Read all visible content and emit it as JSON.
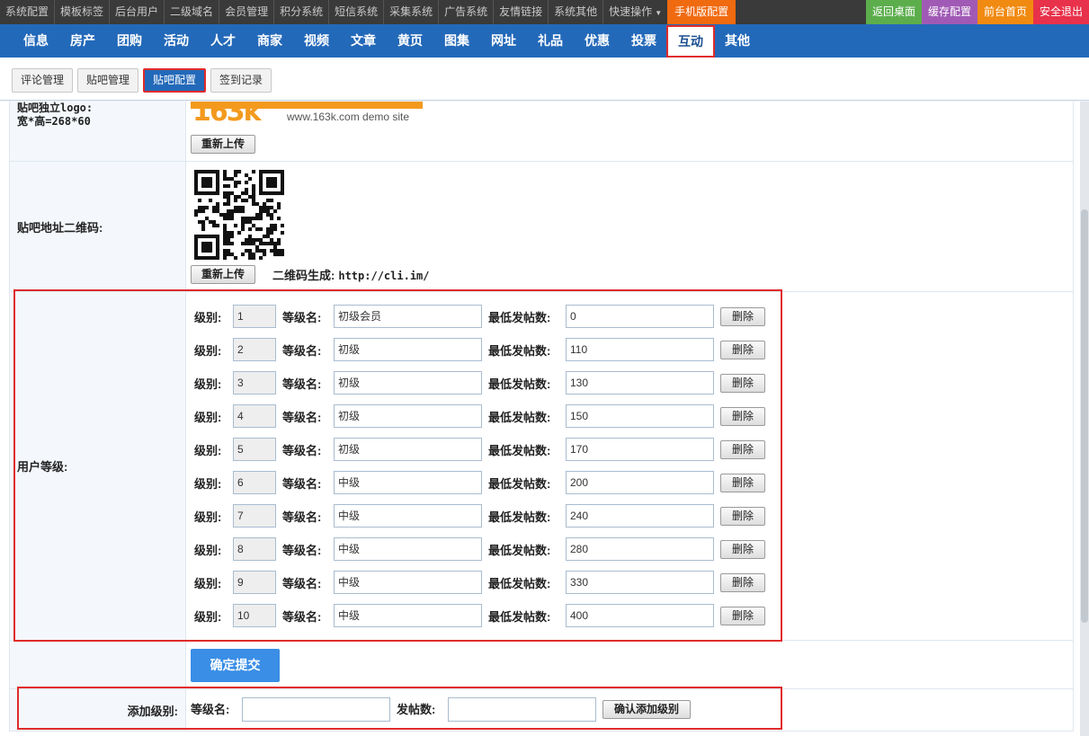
{
  "topbar": {
    "items": [
      "系统配置",
      "模板标签",
      "后台用户",
      "二级域名",
      "会员管理",
      "积分系统",
      "短信系统",
      "采集系统",
      "广告系统",
      "友情链接",
      "系统其他",
      "快速操作"
    ],
    "mobile": "手机版配置",
    "right": [
      {
        "label": "返回桌面",
        "color": "#5cae4c"
      },
      {
        "label": "缓存配置",
        "color": "#a05ab5"
      },
      {
        "label": "前台首页",
        "color": "#f08a10"
      },
      {
        "label": "安全退出",
        "color": "#e8314a"
      }
    ]
  },
  "mainnav": {
    "items": [
      "信息",
      "房产",
      "团购",
      "活动",
      "人才",
      "商家",
      "视频",
      "文章",
      "黄页",
      "图集",
      "网址",
      "礼品",
      "优惠",
      "投票",
      "互动",
      "其他"
    ],
    "active_index": 14
  },
  "subtabs": {
    "items": [
      "评论管理",
      "贴吧管理",
      "贴吧配置",
      "签到记录"
    ],
    "active_index": 2
  },
  "logo_row": {
    "label_line1": "贴吧独立logo:",
    "label_line2": "宽*高=268*60",
    "logo_text": "163k",
    "logo_site": "www.163k.com demo site",
    "upload_button": "重新上传"
  },
  "qr_row": {
    "label": "贴吧地址二维码:",
    "upload_button": "重新上传",
    "gen_label": "二维码生成:",
    "gen_url": "http://cli.im/"
  },
  "levels": {
    "label": "用户等级:",
    "level_label": "级别:",
    "name_label": "等级名:",
    "min_label": "最低发帖数:",
    "delete_label": "删除",
    "rows": [
      {
        "level": "1",
        "name": "初级会员",
        "min": "0"
      },
      {
        "level": "2",
        "name": "初级",
        "min": "110"
      },
      {
        "level": "3",
        "name": "初级",
        "min": "130"
      },
      {
        "level": "4",
        "name": "初级",
        "min": "150"
      },
      {
        "level": "5",
        "name": "初级",
        "min": "170"
      },
      {
        "level": "6",
        "name": "中级",
        "min": "200"
      },
      {
        "level": "7",
        "name": "中级",
        "min": "240"
      },
      {
        "level": "8",
        "name": "中级",
        "min": "280"
      },
      {
        "level": "9",
        "name": "中级",
        "min": "330"
      },
      {
        "level": "10",
        "name": "中级",
        "min": "400"
      }
    ]
  },
  "submit": {
    "label": "确定提交"
  },
  "add_level": {
    "label": "添加级别:",
    "name_label": "等级名:",
    "count_label": "发帖数:",
    "button": "确认添加级别"
  }
}
